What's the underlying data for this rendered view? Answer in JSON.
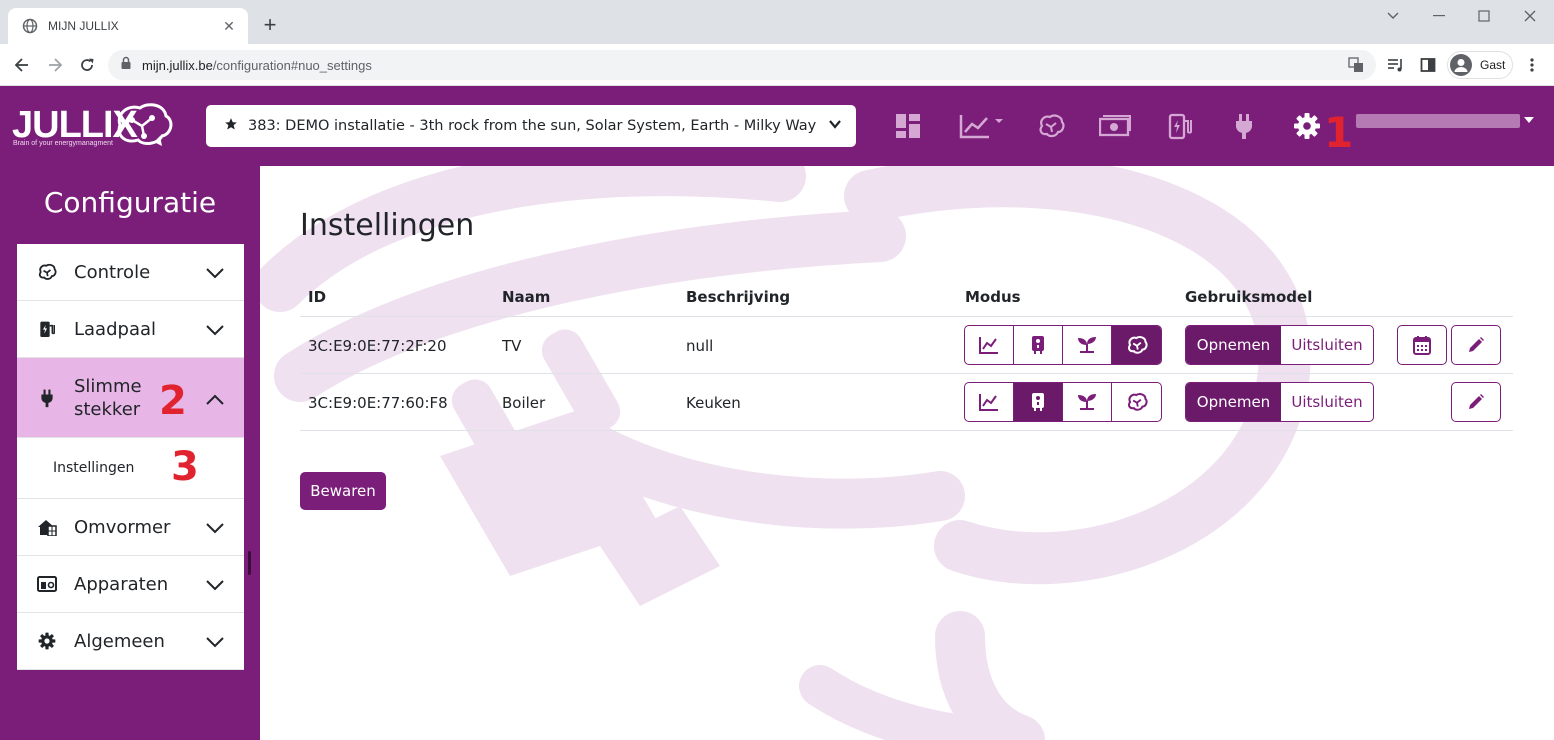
{
  "browser": {
    "tab_title": "MIJN JULLIX",
    "url_host": "mijn.jullix.be",
    "url_path": "/configuration#nuo_settings",
    "profile_label": "Gast"
  },
  "header": {
    "logo_text": "JULLIX",
    "logo_tagline": "Brain of your energymanagment",
    "installation": "383: DEMO installatie - 3th rock from the sun, Solar System, Earth - Milky Way",
    "icons": [
      "dashboard-icon",
      "chart-icon",
      "brain-icon",
      "money-icon",
      "charger-icon",
      "plug-icon",
      "gear-icon"
    ]
  },
  "annotations": {
    "one": "1",
    "two": "2",
    "three": "3"
  },
  "sidebar": {
    "title": "Configuratie",
    "items": [
      {
        "label": "Controle",
        "icon": "brain-icon"
      },
      {
        "label": "Laadpaal",
        "icon": "charger-icon"
      },
      {
        "label": "Slimme stekker",
        "icon": "plug-icon"
      },
      {
        "label": "Instellingen"
      },
      {
        "label": "Omvormer",
        "icon": "solar-house-icon"
      },
      {
        "label": "Apparaten",
        "icon": "devices-icon"
      },
      {
        "label": "Algemeen",
        "icon": "gear-icon"
      }
    ]
  },
  "main": {
    "title": "Instellingen",
    "columns": [
      "ID",
      "Naam",
      "Beschrijving",
      "Modus",
      "Gebruiksmodel"
    ],
    "rows": [
      {
        "id": "3C:E9:0E:77:2F:20",
        "name": "TV",
        "description": "null",
        "mode_active": "brain"
      },
      {
        "id": "3C:E9:0E:77:60:F8",
        "name": "Boiler",
        "description": "Keuken",
        "mode_active": "boiler"
      }
    ],
    "usage_on": "Opnemen",
    "usage_off": "Uitsluiten",
    "save_label": "Bewaren"
  },
  "colors": {
    "brand": "#7b1e7a",
    "brand_dark": "#6b1a6a",
    "active_menu": "#e7b5e6",
    "annotation": "#e0232f"
  }
}
